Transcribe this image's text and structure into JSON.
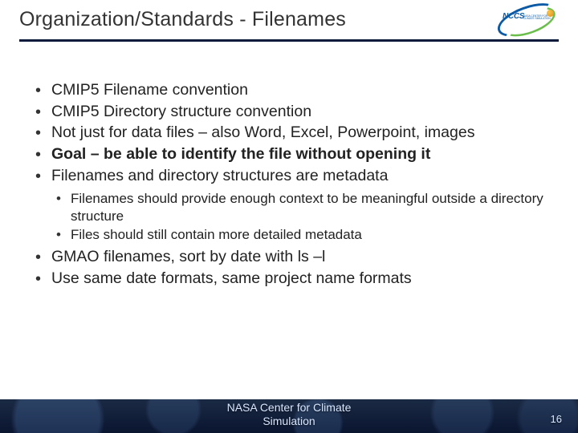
{
  "title": "Organization/Standards - Filenames",
  "logo": {
    "text": "NCCS",
    "subtitle": "NASA CENTER FOR\nCLIMATE SIMULATION"
  },
  "bullets": {
    "b0": "CMIP5 Filename convention",
    "b1": "CMIP5 Directory structure convention",
    "b2": "Not just for data files – also Word, Excel, Powerpoint, images",
    "b3": "Goal – be able to identify the file without opening it",
    "b4": "Filenames and directory structures are metadata",
    "b5": "GMAO filenames, sort by date with ls –l",
    "b6": "Use same date formats, same project name formats"
  },
  "sub": {
    "s0": "Filenames should provide enough context to be meaningful outside a directory structure",
    "s1": "Files should still contain more detailed metadata"
  },
  "footer": {
    "caption_l1": "NASA Center for Climate",
    "caption_l2": "Simulation",
    "page": "16"
  }
}
